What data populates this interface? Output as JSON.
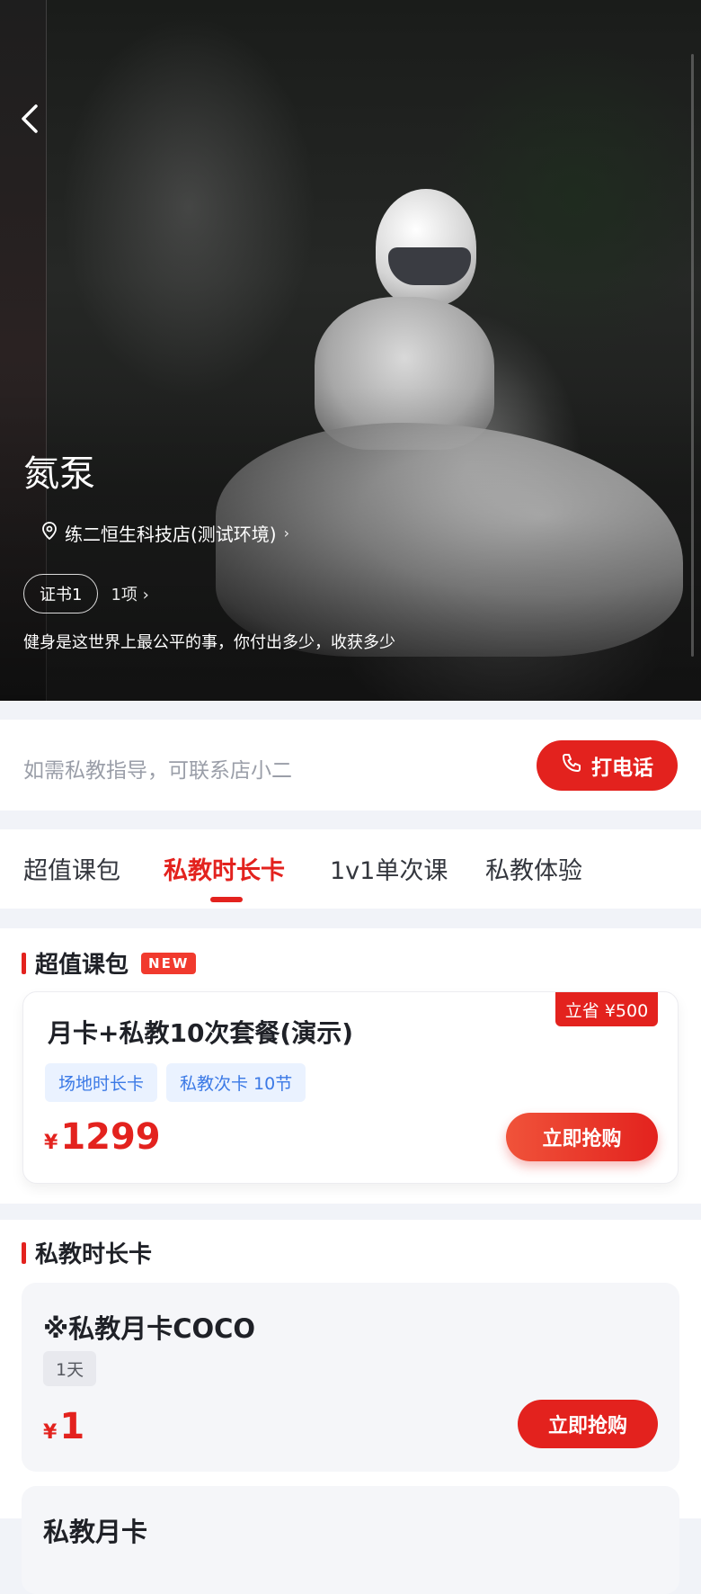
{
  "hero": {
    "coach_name": "氮泵",
    "location": "练二恒生科技店(测试环境)",
    "cert_label": "证书1",
    "cert_count": "1项",
    "motto": "健身是这世界上最公平的事，你付出多少，收获多少",
    "icons": [
      "back-arrow-icon",
      "location-pin-icon",
      "chevron-right-icon"
    ]
  },
  "contact": {
    "hint": "如需私教指导，可联系店小二",
    "call_label": "打电话",
    "call_icon": "phone-icon"
  },
  "tabs": [
    {
      "label": "超值课包",
      "active": false
    },
    {
      "label": "私教时长卡",
      "active": true
    },
    {
      "label": "1v1单次课",
      "active": false
    },
    {
      "label": "私教体验",
      "active": false
    }
  ],
  "bundle_section": {
    "title": "超值课包",
    "badge": "NEW",
    "card": {
      "save_tag": "立省 ¥500",
      "title": "月卡+私教10次套餐(演示)",
      "chips": [
        "场地时长卡",
        "私教次卡 10节"
      ],
      "currency": "¥",
      "price": "1299",
      "buy_label": "立即抢购"
    }
  },
  "time_section": {
    "title": "私教时长卡",
    "card": {
      "title": "※私教月卡COCO",
      "tag": "1天",
      "currency": "¥",
      "price": "1",
      "buy_label": "立即抢购"
    },
    "next_card_title": "私教月卡"
  },
  "colors": {
    "accent": "#e3221e",
    "chip_blue": "#3b79e6",
    "chip_bg": "#eaf2ff",
    "page_bg": "#f1f3f8"
  }
}
